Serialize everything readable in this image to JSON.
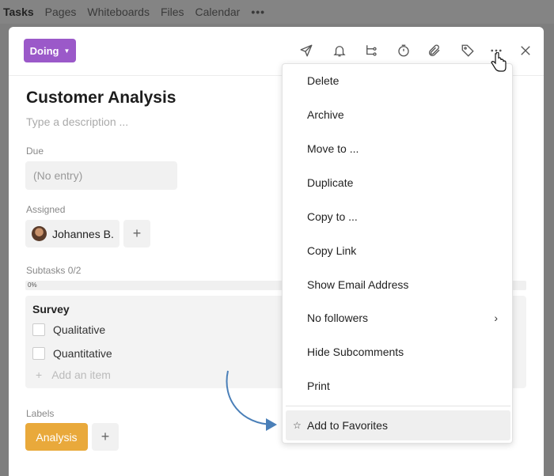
{
  "nav": {
    "items": [
      "Tasks",
      "Pages",
      "Whiteboards",
      "Files",
      "Calendar"
    ],
    "more": "•••"
  },
  "task": {
    "status": "Doing",
    "title": "Customer Analysis",
    "description_placeholder": "Type a description ...",
    "due_label": "Due",
    "due_value": "(No entry)",
    "assigned_label": "Assigned",
    "assignee": "Johannes B.",
    "subtasks_label": "Subtasks 0/2",
    "progress_text": "0%",
    "progress_value": 0,
    "checklist": {
      "title": "Survey",
      "items": [
        "Qualitative",
        "Quantitative"
      ],
      "add_placeholder": "Add an item",
      "add_symbol": "+"
    },
    "labels_label": "Labels",
    "label": "Analysis",
    "label_color": "#e9a93b",
    "status_color": "#9b59c9",
    "plus": "+"
  },
  "toolbar": {
    "icons": [
      "send-icon",
      "bell-icon",
      "subtask-icon",
      "timer-icon",
      "paperclip-icon",
      "tag-icon",
      "more-icon",
      "close-icon"
    ]
  },
  "menu": {
    "items": [
      "Delete",
      "Archive",
      "Move to ...",
      "Duplicate",
      "Copy to ...",
      "Copy Link",
      "Show Email Address",
      "No followers",
      "Hide Subcomments",
      "Print"
    ],
    "submenu_chevron": "›",
    "favorite": "Add to Favorites",
    "favorite_icon": "☆"
  }
}
